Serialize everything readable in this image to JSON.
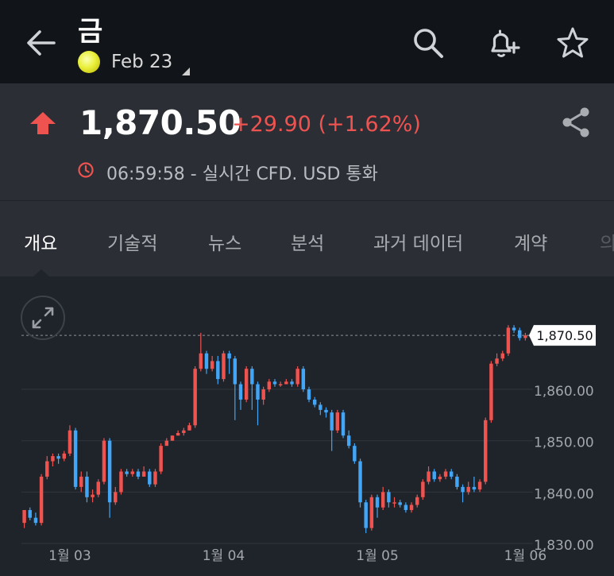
{
  "header": {
    "title": "금",
    "contract_label": "Feb 23",
    "icons": [
      "back-arrow-icon",
      "search-icon",
      "add-alert-icon",
      "star-icon"
    ]
  },
  "quote": {
    "price": "1,870.50",
    "change": "+29.90 (+1.62%)",
    "direction": "up",
    "time_info": "06:59:58 - 실시간 CFD. USD 통화",
    "colors": {
      "up": "#ef5350",
      "down": "#42a5f5"
    }
  },
  "tabs": [
    {
      "label": "개요",
      "active": true
    },
    {
      "label": "기술적",
      "active": false
    },
    {
      "label": "뉴스",
      "active": false
    },
    {
      "label": "분석",
      "active": false
    },
    {
      "label": "과거 데이터",
      "active": false
    },
    {
      "label": "계약",
      "active": false
    },
    {
      "label": "의",
      "active": false
    }
  ],
  "chart_data": {
    "type": "candlestick",
    "current_value_label": "1,870.50",
    "current_value": 1870.5,
    "ylim": [
      1830,
      1873
    ],
    "y_ticks": [
      1830,
      1840,
      1850,
      1860
    ],
    "y_tick_labels": [
      "1,830.00",
      "1,840.00",
      "1,850.00",
      "1,860.00"
    ],
    "x_tick_labels": [
      "1월 03",
      "1월 04",
      "1월 05",
      "1월 06",
      "1월 06"
    ],
    "x_tick_index": [
      8,
      35,
      62,
      88,
      115
    ],
    "grid": true,
    "candles": [
      [
        1834,
        1836.5,
        1833,
        1836.5
      ],
      [
        1836.5,
        1835,
        1834.5,
        1837
      ],
      [
        1835,
        1834,
        1833.5,
        1836
      ],
      [
        1834,
        1843,
        1833.5,
        1843.5
      ],
      [
        1843,
        1846,
        1842.5,
        1847
      ],
      [
        1846,
        1847,
        1845,
        1847.5
      ],
      [
        1847,
        1846.5,
        1845.5,
        1847.5
      ],
      [
        1846.5,
        1847.5,
        1846,
        1848
      ],
      [
        1847.5,
        1852,
        1847,
        1853
      ],
      [
        1852,
        1841,
        1840.5,
        1852.5
      ],
      [
        1841,
        1843,
        1840,
        1844
      ],
      [
        1843,
        1839,
        1838,
        1844
      ],
      [
        1839,
        1839.5,
        1838,
        1840.5
      ],
      [
        1839.5,
        1842,
        1839,
        1842.5
      ],
      [
        1842,
        1850,
        1841.5,
        1850.5
      ],
      [
        1850,
        1838,
        1835,
        1850.5
      ],
      [
        1838,
        1840,
        1837.5,
        1841
      ],
      [
        1840,
        1844,
        1839.5,
        1844.5
      ],
      [
        1844,
        1843.5,
        1843,
        1844.5
      ],
      [
        1843.5,
        1844,
        1843,
        1844.5
      ],
      [
        1844,
        1843,
        1842.5,
        1844.5
      ],
      [
        1843,
        1844,
        1843,
        1845
      ],
      [
        1844,
        1841.5,
        1841,
        1844.5
      ],
      [
        1841.5,
        1844,
        1841,
        1844.5
      ],
      [
        1844,
        1849,
        1843.5,
        1849.5
      ],
      [
        1849,
        1850,
        1849,
        1850.5
      ],
      [
        1850,
        1851,
        1850,
        1851
      ],
      [
        1851,
        1851.5,
        1851,
        1852
      ],
      [
        1851.5,
        1852,
        1851,
        1852.5
      ],
      [
        1852,
        1853,
        1852,
        1853.5
      ],
      [
        1853,
        1864,
        1852.5,
        1864.5
      ],
      [
        1864,
        1867,
        1863.5,
        1871
      ],
      [
        1867,
        1864,
        1863,
        1867.5
      ],
      [
        1864,
        1865.5,
        1863.5,
        1866.5
      ],
      [
        1865.5,
        1862,
        1861,
        1866.5
      ],
      [
        1862,
        1867,
        1861.5,
        1867.5
      ],
      [
        1867,
        1866,
        1863,
        1867.5
      ],
      [
        1866,
        1861,
        1854,
        1866.5
      ],
      [
        1861,
        1858,
        1856,
        1861.5
      ],
      [
        1858,
        1864,
        1857.5,
        1864.5
      ],
      [
        1864,
        1861,
        1856,
        1864.5
      ],
      [
        1861,
        1858,
        1853,
        1861.5
      ],
      [
        1858,
        1860,
        1857,
        1860.5
      ],
      [
        1860,
        1861.5,
        1859.5,
        1862
      ],
      [
        1861.5,
        1861,
        1860.5,
        1862
      ],
      [
        1861,
        1861,
        1860.5,
        1861.5
      ],
      [
        1861,
        1861.5,
        1861,
        1862
      ],
      [
        1861.5,
        1861,
        1860.5,
        1862
      ],
      [
        1861,
        1864,
        1860.5,
        1864.5
      ],
      [
        1864,
        1860,
        1859.5,
        1864.5
      ],
      [
        1860,
        1858,
        1857.5,
        1860.5
      ],
      [
        1858,
        1857,
        1856.5,
        1858.5
      ],
      [
        1857,
        1856,
        1855,
        1857.5
      ],
      [
        1856,
        1855.5,
        1854.5,
        1856.5
      ],
      [
        1855.5,
        1852,
        1848,
        1856
      ],
      [
        1852,
        1855.5,
        1851.5,
        1856
      ],
      [
        1855.5,
        1851,
        1850.5,
        1856
      ],
      [
        1851,
        1849,
        1848.5,
        1852
      ],
      [
        1849,
        1846,
        1845.5,
        1849.5
      ],
      [
        1846,
        1838,
        1837,
        1846.5
      ],
      [
        1838,
        1833,
        1832,
        1838.5
      ],
      [
        1833,
        1839,
        1832.5,
        1839.5
      ],
      [
        1839,
        1837,
        1835,
        1839.5
      ],
      [
        1837,
        1840,
        1836.5,
        1841
      ],
      [
        1840,
        1838,
        1837,
        1840.5
      ],
      [
        1838,
        1838,
        1837,
        1839
      ],
      [
        1838,
        1837.5,
        1837,
        1838.5
      ],
      [
        1837.5,
        1836.5,
        1836,
        1838
      ],
      [
        1836.5,
        1837.5,
        1836,
        1838
      ],
      [
        1837.5,
        1839,
        1837,
        1839.5
      ],
      [
        1839,
        1842,
        1838.5,
        1842.5
      ],
      [
        1842,
        1844,
        1841.5,
        1845
      ],
      [
        1844,
        1842.5,
        1842,
        1844.5
      ],
      [
        1842.5,
        1843,
        1842,
        1843.5
      ],
      [
        1843,
        1844,
        1842.5,
        1844.5
      ],
      [
        1844,
        1843,
        1842.5,
        1844.5
      ],
      [
        1843,
        1841,
        1840.5,
        1843.5
      ],
      [
        1841,
        1840,
        1838,
        1841.5
      ],
      [
        1840,
        1841,
        1839.5,
        1842
      ],
      [
        1841,
        1840.5,
        1840,
        1843
      ],
      [
        1840.5,
        1842,
        1840,
        1842.5
      ],
      [
        1842,
        1854,
        1841.5,
        1854.5
      ],
      [
        1854,
        1865,
        1853.5,
        1865.5
      ],
      [
        1865,
        1866,
        1864.5,
        1867
      ],
      [
        1866,
        1867,
        1865.5,
        1867.5
      ],
      [
        1867,
        1872,
        1866.5,
        1872.5
      ],
      [
        1872,
        1871.5,
        1871,
        1872.5
      ],
      [
        1871.5,
        1870,
        1869.5,
        1872
      ],
      [
        1870,
        1870.5,
        1869.5,
        1871
      ]
    ]
  }
}
